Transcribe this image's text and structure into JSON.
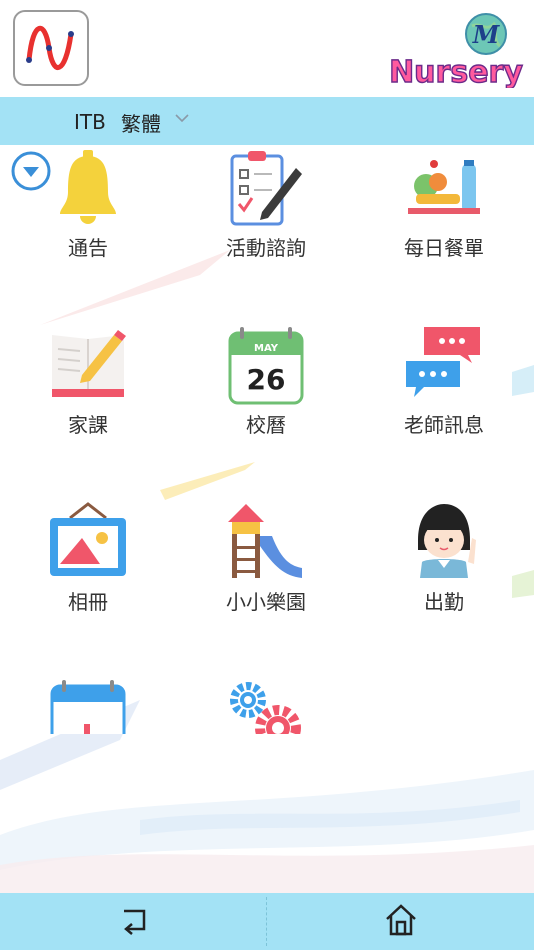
{
  "header": {
    "brand_name": "Nursery",
    "brand_badge": "M"
  },
  "language": {
    "code": "ITB",
    "selected": "繁體"
  },
  "menu": {
    "items": [
      {
        "label": "通告",
        "icon": "bell-icon"
      },
      {
        "label": "活動諮詢",
        "icon": "clipboard-icon"
      },
      {
        "label": "每日餐單",
        "icon": "meal-icon"
      },
      {
        "label": "家課",
        "icon": "book-icon"
      },
      {
        "label": "校曆",
        "icon": "calendar-icon",
        "month": "MAY",
        "day": "26"
      },
      {
        "label": "老師訊息",
        "icon": "chat-icon"
      },
      {
        "label": "相冊",
        "icon": "picture-frame-icon"
      },
      {
        "label": "小小樂園",
        "icon": "playground-icon"
      },
      {
        "label": "出勤",
        "icon": "student-icon"
      },
      {
        "label": "",
        "icon": "calendar-icon"
      },
      {
        "label": "",
        "icon": "gears-icon"
      }
    ]
  },
  "colors": {
    "accent": "#a3e2f5",
    "toggle": "#3a8fd8",
    "bell": "#f4d23c",
    "calendar_green": "#6fbf73",
    "chat_red": "#f0566a",
    "chat_blue": "#3ea0ea"
  }
}
